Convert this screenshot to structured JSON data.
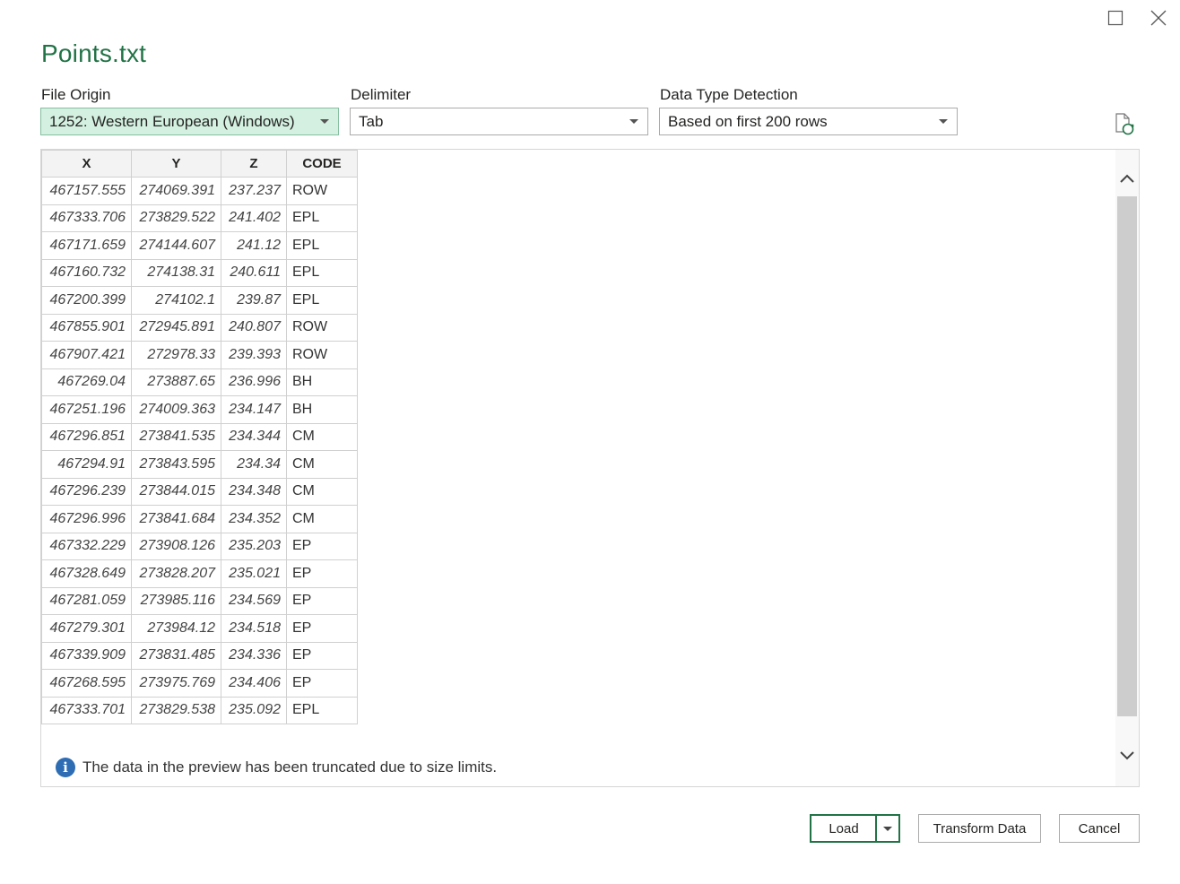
{
  "dialog": {
    "title": "Points.txt"
  },
  "options": {
    "file_origin": {
      "label": "File Origin",
      "value": "1252: Western European (Windows)"
    },
    "delimiter": {
      "label": "Delimiter",
      "value": "Tab"
    },
    "data_type_detection": {
      "label": "Data Type Detection",
      "value": "Based on first 200 rows"
    }
  },
  "table": {
    "headers": [
      "X",
      "Y",
      "Z",
      "CODE"
    ],
    "rows": [
      [
        "467157.555",
        "274069.391",
        "237.237",
        "ROW"
      ],
      [
        "467333.706",
        "273829.522",
        "241.402",
        "EPL"
      ],
      [
        "467171.659",
        "274144.607",
        "241.12",
        "EPL"
      ],
      [
        "467160.732",
        "274138.31",
        "240.611",
        "EPL"
      ],
      [
        "467200.399",
        "274102.1",
        "239.87",
        "EPL"
      ],
      [
        "467855.901",
        "272945.891",
        "240.807",
        "ROW"
      ],
      [
        "467907.421",
        "272978.33",
        "239.393",
        "ROW"
      ],
      [
        "467269.04",
        "273887.65",
        "236.996",
        "BH"
      ],
      [
        "467251.196",
        "274009.363",
        "234.147",
        "BH"
      ],
      [
        "467296.851",
        "273841.535",
        "234.344",
        "CM"
      ],
      [
        "467294.91",
        "273843.595",
        "234.34",
        "CM"
      ],
      [
        "467296.239",
        "273844.015",
        "234.348",
        "CM"
      ],
      [
        "467296.996",
        "273841.684",
        "234.352",
        "CM"
      ],
      [
        "467332.229",
        "273908.126",
        "235.203",
        "EP"
      ],
      [
        "467328.649",
        "273828.207",
        "235.021",
        "EP"
      ],
      [
        "467281.059",
        "273985.116",
        "234.569",
        "EP"
      ],
      [
        "467279.301",
        "273984.12",
        "234.518",
        "EP"
      ],
      [
        "467339.909",
        "273831.485",
        "234.336",
        "EP"
      ],
      [
        "467268.595",
        "273975.769",
        "234.406",
        "EP"
      ],
      [
        "467333.701",
        "273829.538",
        "235.092",
        "EPL"
      ]
    ]
  },
  "notice": {
    "icon": "info-icon",
    "text": "The data in the preview has been truncated due to size limits."
  },
  "buttons": {
    "load": "Load",
    "transform": "Transform Data",
    "cancel": "Cancel"
  },
  "colors": {
    "accent": "#217346",
    "selected_dropdown": "#d3f0e0"
  }
}
